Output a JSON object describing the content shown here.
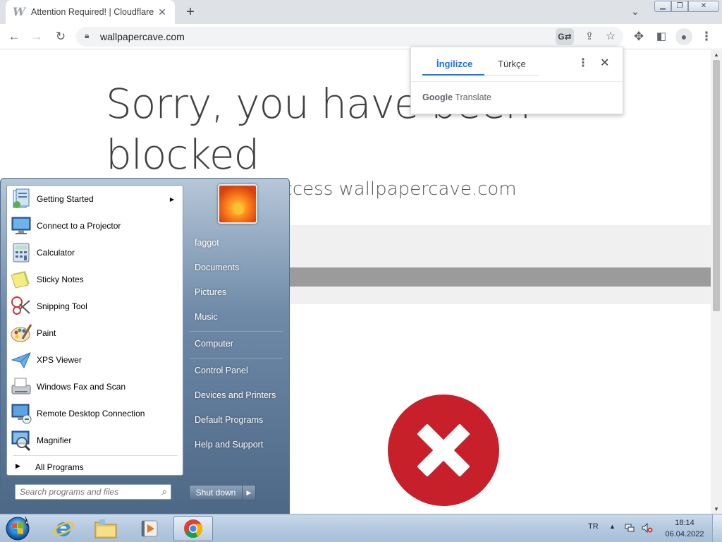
{
  "browser": {
    "tab_title": "Attention Required! | Cloudflare",
    "tab_favicon": "W",
    "tab_close": "✕",
    "new_tab": "+",
    "tab_search": "⌄",
    "url": "wallpapercave.com"
  },
  "page": {
    "headline": "Sorry, you have been blocked",
    "subline": "You are unable to access wallpapercave.com",
    "error_color": "#c8202a"
  },
  "translate_bubble": {
    "source_lang": "İngilizce",
    "target_lang": "Türkçe",
    "brand_google": "Google",
    "brand_translate": "Translate"
  },
  "start_menu": {
    "programs": [
      {
        "label": "Getting Started",
        "icon": "getting-started-icon",
        "submenu": true
      },
      {
        "label": "Connect to a Projector",
        "icon": "projector-icon"
      },
      {
        "label": "Calculator",
        "icon": "calculator-icon"
      },
      {
        "label": "Sticky Notes",
        "icon": "sticky-notes-icon"
      },
      {
        "label": "Snipping Tool",
        "icon": "snipping-tool-icon"
      },
      {
        "label": "Paint",
        "icon": "paint-icon"
      },
      {
        "label": "XPS Viewer",
        "icon": "xps-viewer-icon"
      },
      {
        "label": "Windows Fax and Scan",
        "icon": "fax-scan-icon"
      },
      {
        "label": "Remote Desktop Connection",
        "icon": "remote-desktop-icon"
      },
      {
        "label": "Magnifier",
        "icon": "magnifier-icon"
      }
    ],
    "all_programs": "All Programs",
    "search_placeholder": "Search programs and files",
    "right_links": [
      "faggot",
      "Documents",
      "Pictures",
      "Music",
      "Computer",
      "Control Panel",
      "Devices and Printers",
      "Default Programs",
      "Help and Support"
    ],
    "shutdown_label": "Shut down"
  },
  "taskbar": {
    "language": "TR",
    "time": "18:14",
    "date": "06.04.2022"
  }
}
